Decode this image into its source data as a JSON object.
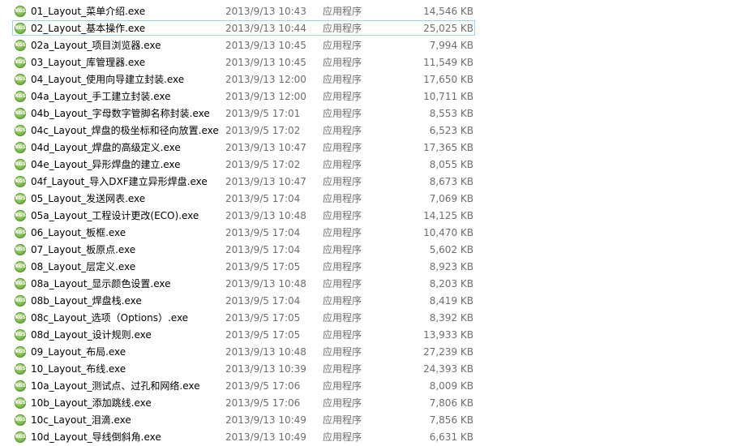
{
  "files": [
    {
      "name": "01_Layout_菜单介绍.exe",
      "date": "2013/9/13 10:43",
      "type": "应用程序",
      "size": "14,546 KB",
      "icon": "kgs-app-icon",
      "icon_text": "KGS"
    },
    {
      "name": "02_Layout_基本操作.exe",
      "date": "2013/9/13 10:44",
      "type": "应用程序",
      "size": "25,025 KB",
      "icon": "kgs-app-icon",
      "icon_text": "KGS",
      "selected": true
    },
    {
      "name": "02a_Layout_项目浏览器.exe",
      "date": "2013/9/13 10:45",
      "type": "应用程序",
      "size": "7,994 KB",
      "icon": "kgs-app-icon",
      "icon_text": "KGS"
    },
    {
      "name": "03_Layout_库管理器.exe",
      "date": "2013/9/13 10:45",
      "type": "应用程序",
      "size": "11,549 KB",
      "icon": "kgs-app-icon",
      "icon_text": "KGS"
    },
    {
      "name": "04_Layout_使用向导建立封装.exe",
      "date": "2013/9/13 12:00",
      "type": "应用程序",
      "size": "17,650 KB",
      "icon": "kgs-app-icon",
      "icon_text": "KGS"
    },
    {
      "name": "04a_Layout_手工建立封装.exe",
      "date": "2013/9/13 12:00",
      "type": "应用程序",
      "size": "10,711 KB",
      "icon": "kgs-app-icon",
      "icon_text": "KGS"
    },
    {
      "name": "04b_Layout_字母数字管脚名称封装.exe",
      "date": "2013/9/5 17:01",
      "type": "应用程序",
      "size": "8,553 KB",
      "icon": "kgs-app-icon",
      "icon_text": "KGS"
    },
    {
      "name": "04c_Layout_焊盘的极坐标和径向放置.exe",
      "date": "2013/9/5 17:02",
      "type": "应用程序",
      "size": "6,523 KB",
      "icon": "kgs-app-icon",
      "icon_text": "KGS"
    },
    {
      "name": "04d_Layout_焊盘的高级定义.exe",
      "date": "2013/9/13 10:47",
      "type": "应用程序",
      "size": "17,365 KB",
      "icon": "kgs-app-icon",
      "icon_text": "KGS"
    },
    {
      "name": "04e_Layout_异形焊盘的建立.exe",
      "date": "2013/9/5 17:02",
      "type": "应用程序",
      "size": "8,055 KB",
      "icon": "kgs-app-icon",
      "icon_text": "KGS"
    },
    {
      "name": "04f_Layout_导入DXF建立异形焊盘.exe",
      "date": "2013/9/13 10:47",
      "type": "应用程序",
      "size": "8,673 KB",
      "icon": "kgs-app-icon",
      "icon_text": "KGS"
    },
    {
      "name": "05_Layout_发送网表.exe",
      "date": "2013/9/5 17:04",
      "type": "应用程序",
      "size": "7,069 KB",
      "icon": "kgs-app-icon",
      "icon_text": "KGS"
    },
    {
      "name": "05a_Layout_工程设计更改(ECO).exe",
      "date": "2013/9/13 10:48",
      "type": "应用程序",
      "size": "14,125 KB",
      "icon": "kgs-app-icon",
      "icon_text": "KGS"
    },
    {
      "name": "06_Layout_板框.exe",
      "date": "2013/9/5 17:04",
      "type": "应用程序",
      "size": "10,470 KB",
      "icon": "kgs-app-icon",
      "icon_text": "KGS"
    },
    {
      "name": "07_Layout_板原点.exe",
      "date": "2013/9/5 17:04",
      "type": "应用程序",
      "size": "5,602 KB",
      "icon": "kgs-app-icon",
      "icon_text": "KGS"
    },
    {
      "name": "08_Layout_层定义.exe",
      "date": "2013/9/5 17:05",
      "type": "应用程序",
      "size": "8,923 KB",
      "icon": "kgs-app-icon",
      "icon_text": "KGS"
    },
    {
      "name": "08a_Layout_显示颜色设置.exe",
      "date": "2013/9/13 10:48",
      "type": "应用程序",
      "size": "8,203 KB",
      "icon": "kgs-app-icon",
      "icon_text": "KGS"
    },
    {
      "name": "08b_Layout_焊盘栈.exe",
      "date": "2013/9/5 17:04",
      "type": "应用程序",
      "size": "8,419 KB",
      "icon": "kgs-app-icon",
      "icon_text": "KGS"
    },
    {
      "name": "08c_Layout_选项（Options）.exe",
      "date": "2013/9/5 17:05",
      "type": "应用程序",
      "size": "8,392 KB",
      "icon": "kgs-app-icon",
      "icon_text": "KGS"
    },
    {
      "name": "08d_Layout_设计规则.exe",
      "date": "2013/9/5 17:05",
      "type": "应用程序",
      "size": "13,933 KB",
      "icon": "kgs-app-icon",
      "icon_text": "KGS"
    },
    {
      "name": "09_Layout_布局.exe",
      "date": "2013/9/13 10:48",
      "type": "应用程序",
      "size": "27,239 KB",
      "icon": "kgs-app-icon",
      "icon_text": "KGS"
    },
    {
      "name": "10_Layout_布线.exe",
      "date": "2013/9/13 10:39",
      "type": "应用程序",
      "size": "24,393 KB",
      "icon": "kgs-app-icon",
      "icon_text": "KGS"
    },
    {
      "name": "10a_Layout_测试点、过孔和网络.exe",
      "date": "2013/9/5 17:06",
      "type": "应用程序",
      "size": "8,009 KB",
      "icon": "kgs-app-icon",
      "icon_text": "KGS"
    },
    {
      "name": "10b_Layout_添加跳线.exe",
      "date": "2013/9/5 17:06",
      "type": "应用程序",
      "size": "7,806 KB",
      "icon": "kgs-app-icon",
      "icon_text": "KGS"
    },
    {
      "name": "10c_Layout_泪滴.exe",
      "date": "2013/9/13 10:49",
      "type": "应用程序",
      "size": "7,856 KB",
      "icon": "kgs-app-icon",
      "icon_text": "KGS"
    },
    {
      "name": "10d_Layout_导线倒斜角.exe",
      "date": "2013/9/13 10:49",
      "type": "应用程序",
      "size": "6,631 KB",
      "icon": "kgs-app-icon",
      "icon_text": "KGS"
    }
  ],
  "colors": {
    "selection_border": "#99d1ff",
    "secondary_text": "#6d6d6d",
    "icon_green": "#7ab648"
  }
}
